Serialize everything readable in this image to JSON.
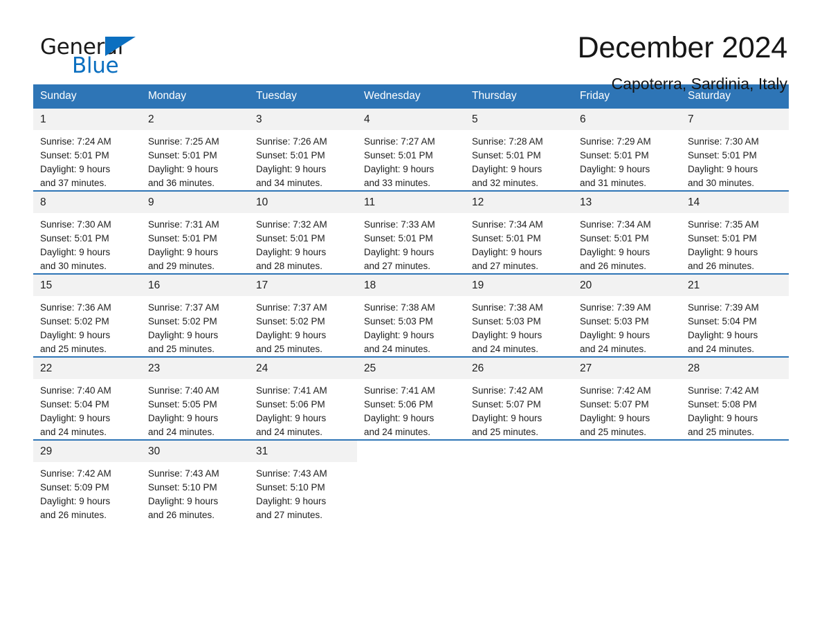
{
  "brand": {
    "name_line1": "General",
    "name_line2": "Blue",
    "accent_color": "#0b6fc0"
  },
  "header": {
    "title": "December 2024",
    "location": "Capoterra, Sardinia, Italy"
  },
  "theme": {
    "header_blue": "#2e75b6",
    "daynum_gray": "#f2f2f2",
    "text": "#1d1d1d"
  },
  "calendar": {
    "weekday_headers": [
      "Sunday",
      "Monday",
      "Tuesday",
      "Wednesday",
      "Thursday",
      "Friday",
      "Saturday"
    ],
    "weeks": [
      [
        {
          "day": "1",
          "sunrise": "Sunrise: 7:24 AM",
          "sunset": "Sunset: 5:01 PM",
          "daylight_line1": "Daylight: 9 hours",
          "daylight_line2": "and 37 minutes."
        },
        {
          "day": "2",
          "sunrise": "Sunrise: 7:25 AM",
          "sunset": "Sunset: 5:01 PM",
          "daylight_line1": "Daylight: 9 hours",
          "daylight_line2": "and 36 minutes."
        },
        {
          "day": "3",
          "sunrise": "Sunrise: 7:26 AM",
          "sunset": "Sunset: 5:01 PM",
          "daylight_line1": "Daylight: 9 hours",
          "daylight_line2": "and 34 minutes."
        },
        {
          "day": "4",
          "sunrise": "Sunrise: 7:27 AM",
          "sunset": "Sunset: 5:01 PM",
          "daylight_line1": "Daylight: 9 hours",
          "daylight_line2": "and 33 minutes."
        },
        {
          "day": "5",
          "sunrise": "Sunrise: 7:28 AM",
          "sunset": "Sunset: 5:01 PM",
          "daylight_line1": "Daylight: 9 hours",
          "daylight_line2": "and 32 minutes."
        },
        {
          "day": "6",
          "sunrise": "Sunrise: 7:29 AM",
          "sunset": "Sunset: 5:01 PM",
          "daylight_line1": "Daylight: 9 hours",
          "daylight_line2": "and 31 minutes."
        },
        {
          "day": "7",
          "sunrise": "Sunrise: 7:30 AM",
          "sunset": "Sunset: 5:01 PM",
          "daylight_line1": "Daylight: 9 hours",
          "daylight_line2": "and 30 minutes."
        }
      ],
      [
        {
          "day": "8",
          "sunrise": "Sunrise: 7:30 AM",
          "sunset": "Sunset: 5:01 PM",
          "daylight_line1": "Daylight: 9 hours",
          "daylight_line2": "and 30 minutes."
        },
        {
          "day": "9",
          "sunrise": "Sunrise: 7:31 AM",
          "sunset": "Sunset: 5:01 PM",
          "daylight_line1": "Daylight: 9 hours",
          "daylight_line2": "and 29 minutes."
        },
        {
          "day": "10",
          "sunrise": "Sunrise: 7:32 AM",
          "sunset": "Sunset: 5:01 PM",
          "daylight_line1": "Daylight: 9 hours",
          "daylight_line2": "and 28 minutes."
        },
        {
          "day": "11",
          "sunrise": "Sunrise: 7:33 AM",
          "sunset": "Sunset: 5:01 PM",
          "daylight_line1": "Daylight: 9 hours",
          "daylight_line2": "and 27 minutes."
        },
        {
          "day": "12",
          "sunrise": "Sunrise: 7:34 AM",
          "sunset": "Sunset: 5:01 PM",
          "daylight_line1": "Daylight: 9 hours",
          "daylight_line2": "and 27 minutes."
        },
        {
          "day": "13",
          "sunrise": "Sunrise: 7:34 AM",
          "sunset": "Sunset: 5:01 PM",
          "daylight_line1": "Daylight: 9 hours",
          "daylight_line2": "and 26 minutes."
        },
        {
          "day": "14",
          "sunrise": "Sunrise: 7:35 AM",
          "sunset": "Sunset: 5:01 PM",
          "daylight_line1": "Daylight: 9 hours",
          "daylight_line2": "and 26 minutes."
        }
      ],
      [
        {
          "day": "15",
          "sunrise": "Sunrise: 7:36 AM",
          "sunset": "Sunset: 5:02 PM",
          "daylight_line1": "Daylight: 9 hours",
          "daylight_line2": "and 25 minutes."
        },
        {
          "day": "16",
          "sunrise": "Sunrise: 7:37 AM",
          "sunset": "Sunset: 5:02 PM",
          "daylight_line1": "Daylight: 9 hours",
          "daylight_line2": "and 25 minutes."
        },
        {
          "day": "17",
          "sunrise": "Sunrise: 7:37 AM",
          "sunset": "Sunset: 5:02 PM",
          "daylight_line1": "Daylight: 9 hours",
          "daylight_line2": "and 25 minutes."
        },
        {
          "day": "18",
          "sunrise": "Sunrise: 7:38 AM",
          "sunset": "Sunset: 5:03 PM",
          "daylight_line1": "Daylight: 9 hours",
          "daylight_line2": "and 24 minutes."
        },
        {
          "day": "19",
          "sunrise": "Sunrise: 7:38 AM",
          "sunset": "Sunset: 5:03 PM",
          "daylight_line1": "Daylight: 9 hours",
          "daylight_line2": "and 24 minutes."
        },
        {
          "day": "20",
          "sunrise": "Sunrise: 7:39 AM",
          "sunset": "Sunset: 5:03 PM",
          "daylight_line1": "Daylight: 9 hours",
          "daylight_line2": "and 24 minutes."
        },
        {
          "day": "21",
          "sunrise": "Sunrise: 7:39 AM",
          "sunset": "Sunset: 5:04 PM",
          "daylight_line1": "Daylight: 9 hours",
          "daylight_line2": "and 24 minutes."
        }
      ],
      [
        {
          "day": "22",
          "sunrise": "Sunrise: 7:40 AM",
          "sunset": "Sunset: 5:04 PM",
          "daylight_line1": "Daylight: 9 hours",
          "daylight_line2": "and 24 minutes."
        },
        {
          "day": "23",
          "sunrise": "Sunrise: 7:40 AM",
          "sunset": "Sunset: 5:05 PM",
          "daylight_line1": "Daylight: 9 hours",
          "daylight_line2": "and 24 minutes."
        },
        {
          "day": "24",
          "sunrise": "Sunrise: 7:41 AM",
          "sunset": "Sunset: 5:06 PM",
          "daylight_line1": "Daylight: 9 hours",
          "daylight_line2": "and 24 minutes."
        },
        {
          "day": "25",
          "sunrise": "Sunrise: 7:41 AM",
          "sunset": "Sunset: 5:06 PM",
          "daylight_line1": "Daylight: 9 hours",
          "daylight_line2": "and 24 minutes."
        },
        {
          "day": "26",
          "sunrise": "Sunrise: 7:42 AM",
          "sunset": "Sunset: 5:07 PM",
          "daylight_line1": "Daylight: 9 hours",
          "daylight_line2": "and 25 minutes."
        },
        {
          "day": "27",
          "sunrise": "Sunrise: 7:42 AM",
          "sunset": "Sunset: 5:07 PM",
          "daylight_line1": "Daylight: 9 hours",
          "daylight_line2": "and 25 minutes."
        },
        {
          "day": "28",
          "sunrise": "Sunrise: 7:42 AM",
          "sunset": "Sunset: 5:08 PM",
          "daylight_line1": "Daylight: 9 hours",
          "daylight_line2": "and 25 minutes."
        }
      ],
      [
        {
          "day": "29",
          "sunrise": "Sunrise: 7:42 AM",
          "sunset": "Sunset: 5:09 PM",
          "daylight_line1": "Daylight: 9 hours",
          "daylight_line2": "and 26 minutes."
        },
        {
          "day": "30",
          "sunrise": "Sunrise: 7:43 AM",
          "sunset": "Sunset: 5:10 PM",
          "daylight_line1": "Daylight: 9 hours",
          "daylight_line2": "and 26 minutes."
        },
        {
          "day": "31",
          "sunrise": "Sunrise: 7:43 AM",
          "sunset": "Sunset: 5:10 PM",
          "daylight_line1": "Daylight: 9 hours",
          "daylight_line2": "and 27 minutes."
        },
        {
          "day": "",
          "sunrise": "",
          "sunset": "",
          "daylight_line1": "",
          "daylight_line2": ""
        },
        {
          "day": "",
          "sunrise": "",
          "sunset": "",
          "daylight_line1": "",
          "daylight_line2": ""
        },
        {
          "day": "",
          "sunrise": "",
          "sunset": "",
          "daylight_line1": "",
          "daylight_line2": ""
        },
        {
          "day": "",
          "sunrise": "",
          "sunset": "",
          "daylight_line1": "",
          "daylight_line2": ""
        }
      ]
    ]
  }
}
